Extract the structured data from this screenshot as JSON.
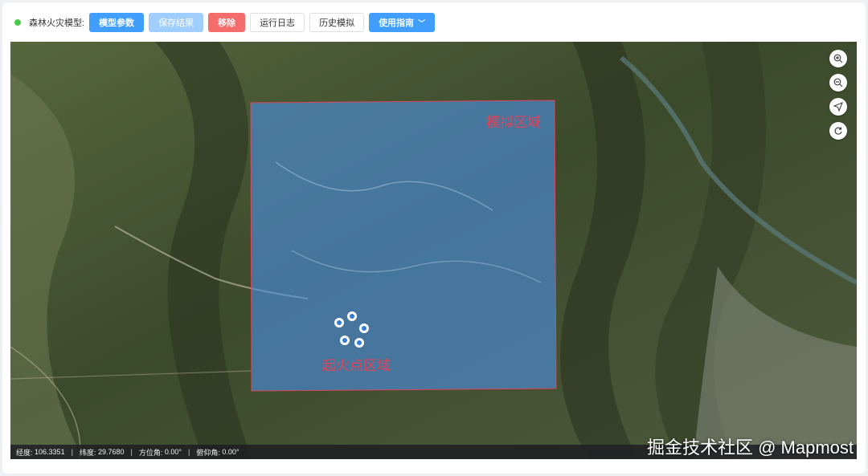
{
  "toolbar": {
    "model_label": "森林火灾模型:",
    "buttons": {
      "model_params": "模型参数",
      "save_result": "保存结果",
      "remove": "移除",
      "run_log": "运行日志",
      "history": "历史模拟",
      "guide": "使用指南"
    }
  },
  "map": {
    "simulation_region_label": "模拟区域",
    "ignition_region_label": "起火点区域",
    "controls": [
      "zoom-in-icon",
      "zoom-out-icon",
      "locate-icon",
      "reset-icon"
    ]
  },
  "statusbar": {
    "lon_label": "经度:",
    "lon_value": "106.3351",
    "lat_label": "纬度:",
    "lat_value": "29.7680",
    "azimuth_label": "方位角:",
    "azimuth_value": "0.00°",
    "pitch_label": "俯仰角:",
    "pitch_value": "0.00°"
  },
  "watermark": "掘金技术社区 @ Mapmost",
  "colors": {
    "primary": "#409eff",
    "danger": "#f56c6c",
    "region_fill": "#4a90e2",
    "region_label": "#e0445a"
  }
}
